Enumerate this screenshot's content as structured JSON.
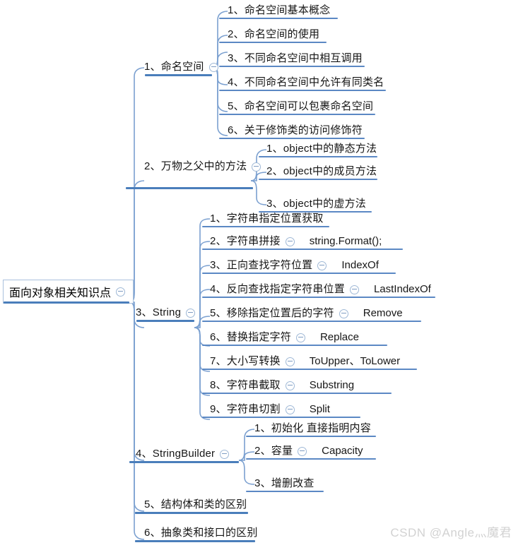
{
  "title": "面向对象相关知识点",
  "root": {
    "label": "面向对象相关知识点",
    "toggle": "collapse-toggle-icon"
  },
  "watermark": "CSDN @Angle灬魔君",
  "colors": {
    "branch_line": "#4a7ebb",
    "connector": "#7ba0d0",
    "toggle_border": "#9fb8d6",
    "text": "#161616",
    "watermark": "#d2d2d2",
    "background": "#ffffff"
  },
  "branches": [
    {
      "index": "1",
      "label": "1、命名空间",
      "children": [
        {
          "label": "1、命名空间基本概念"
        },
        {
          "label": "2、命名空间的使用"
        },
        {
          "label": "3、不同命名空间中相互调用"
        },
        {
          "label": "4、不同命名空间中允许有同类名"
        },
        {
          "label": "5、命名空间可以包裹命名空间"
        },
        {
          "label": "6、关于修饰类的访问修饰符"
        }
      ]
    },
    {
      "index": "2",
      "label": "2、万物之父中的方法",
      "children": [
        {
          "label": "1、object中的静态方法"
        },
        {
          "label": "2、object中的成员方法"
        },
        {
          "label": "3、object中的虚方法"
        }
      ]
    },
    {
      "index": "3",
      "label": "3、String",
      "children": [
        {
          "label": "1、字符串指定位置获取"
        },
        {
          "label": "2、字符串拼接",
          "sub": "string.Format();"
        },
        {
          "label": "3、正向查找字符位置",
          "sub": "IndexOf"
        },
        {
          "label": "4、反向查找指定字符串位置",
          "sub": "LastIndexOf"
        },
        {
          "label": "5、移除指定位置后的字符",
          "sub": "Remove"
        },
        {
          "label": "6、替换指定字符",
          "sub": "Replace"
        },
        {
          "label": "7、大小写转换",
          "sub": "ToUpper、ToLower"
        },
        {
          "label": "8、字符串截取",
          "sub": "Substring"
        },
        {
          "label": "9、字符串切割",
          "sub": "Split"
        }
      ]
    },
    {
      "index": "4",
      "label": "4、StringBuilder",
      "children": [
        {
          "label": "1、初始化 直接指明内容"
        },
        {
          "label": "2、容量",
          "sub": "Capacity"
        },
        {
          "label": "3、增删改查"
        }
      ]
    },
    {
      "index": "5",
      "label": "5、结构体和类的区别",
      "children": []
    },
    {
      "index": "6",
      "label": "6、抽象类和接口的区别",
      "children": []
    }
  ]
}
